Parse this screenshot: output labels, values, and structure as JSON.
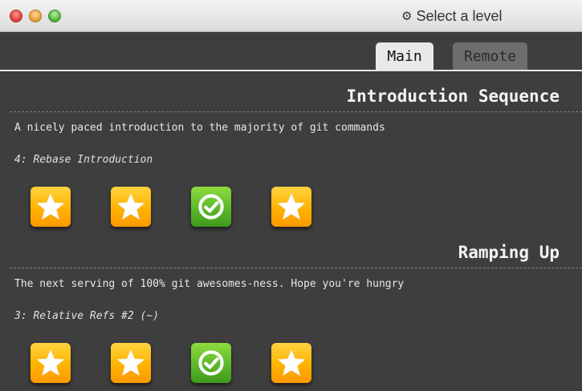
{
  "window": {
    "title": "Select a level",
    "icon": "gear-icon"
  },
  "tabs": [
    {
      "label": "Main",
      "active": true
    },
    {
      "label": "Remote",
      "active": false
    }
  ],
  "sections": [
    {
      "title": "Introduction Sequence",
      "description": "A nicely paced introduction to the majority of git commands",
      "current_level": "4: Rebase Introduction",
      "levels": [
        {
          "status": "unsolved",
          "icon": "star-icon"
        },
        {
          "status": "unsolved",
          "icon": "star-icon"
        },
        {
          "status": "solved",
          "icon": "checkmark-icon"
        },
        {
          "status": "unsolved",
          "icon": "star-icon"
        }
      ]
    },
    {
      "title": "Ramping Up",
      "description": "The next serving of 100% git awesomes-ness. Hope you're hungry",
      "current_level": "3: Relative Refs #2 (~)",
      "levels": [
        {
          "status": "unsolved",
          "icon": "star-icon"
        },
        {
          "status": "unsolved",
          "icon": "star-icon"
        },
        {
          "status": "solved",
          "icon": "checkmark-icon"
        },
        {
          "status": "unsolved",
          "icon": "star-icon"
        }
      ]
    }
  ],
  "colors": {
    "star": "#ffb300",
    "solved": "#5cb82a",
    "background": "#3e3e3e"
  }
}
